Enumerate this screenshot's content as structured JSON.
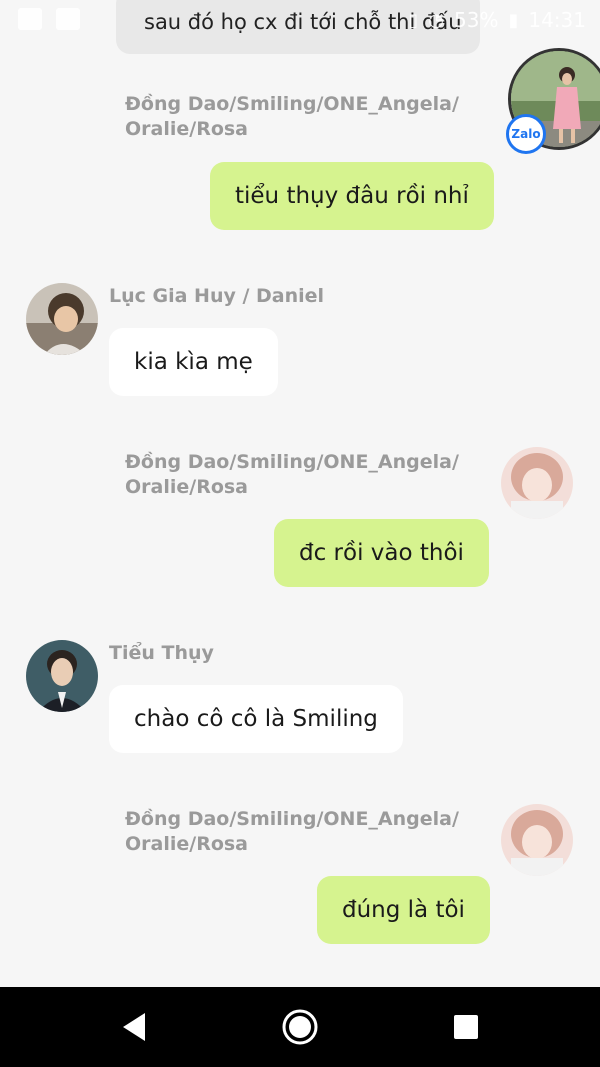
{
  "status_bar": {
    "battery": "53%",
    "time": "14:31",
    "icons": [
      "gallery-icon",
      "zalo-notify-icon",
      "vibrate-icon",
      "wifi-icon",
      "battery-icon"
    ]
  },
  "floating_bubble": {
    "badge_label": "Zalo"
  },
  "messages": [
    {
      "type": "partial",
      "text": "sau đó họ cx đi tới chỗ thi đấu"
    },
    {
      "sender": "Đồng Dao/Smiling/ONE_Angela/\nOralie/Rosa",
      "text": "tiểu thụy đâu rồi nhỉ",
      "direction": "out"
    },
    {
      "sender": "Lục Gia Huy / Daniel",
      "text": "kia kìa mẹ",
      "direction": "in"
    },
    {
      "sender": "Đồng Dao/Smiling/ONE_Angela/\nOralie/Rosa",
      "text": "đc rồi vào thôi",
      "direction": "out"
    },
    {
      "sender": "Tiểu Thụy",
      "text": "chào cô cô là Smiling",
      "direction": "in"
    },
    {
      "sender": "Đồng Dao/Smiling/ONE_Angela/\nOralie/Rosa",
      "text": "đúng là tôi",
      "direction": "out"
    }
  ],
  "colors": {
    "background": "#f6f6f6",
    "outgoing_bubble": "#d6f38f",
    "incoming_bubble": "#ffffff",
    "sender_name": "#9a9a9a",
    "zalo_blue": "#1f75f0"
  }
}
